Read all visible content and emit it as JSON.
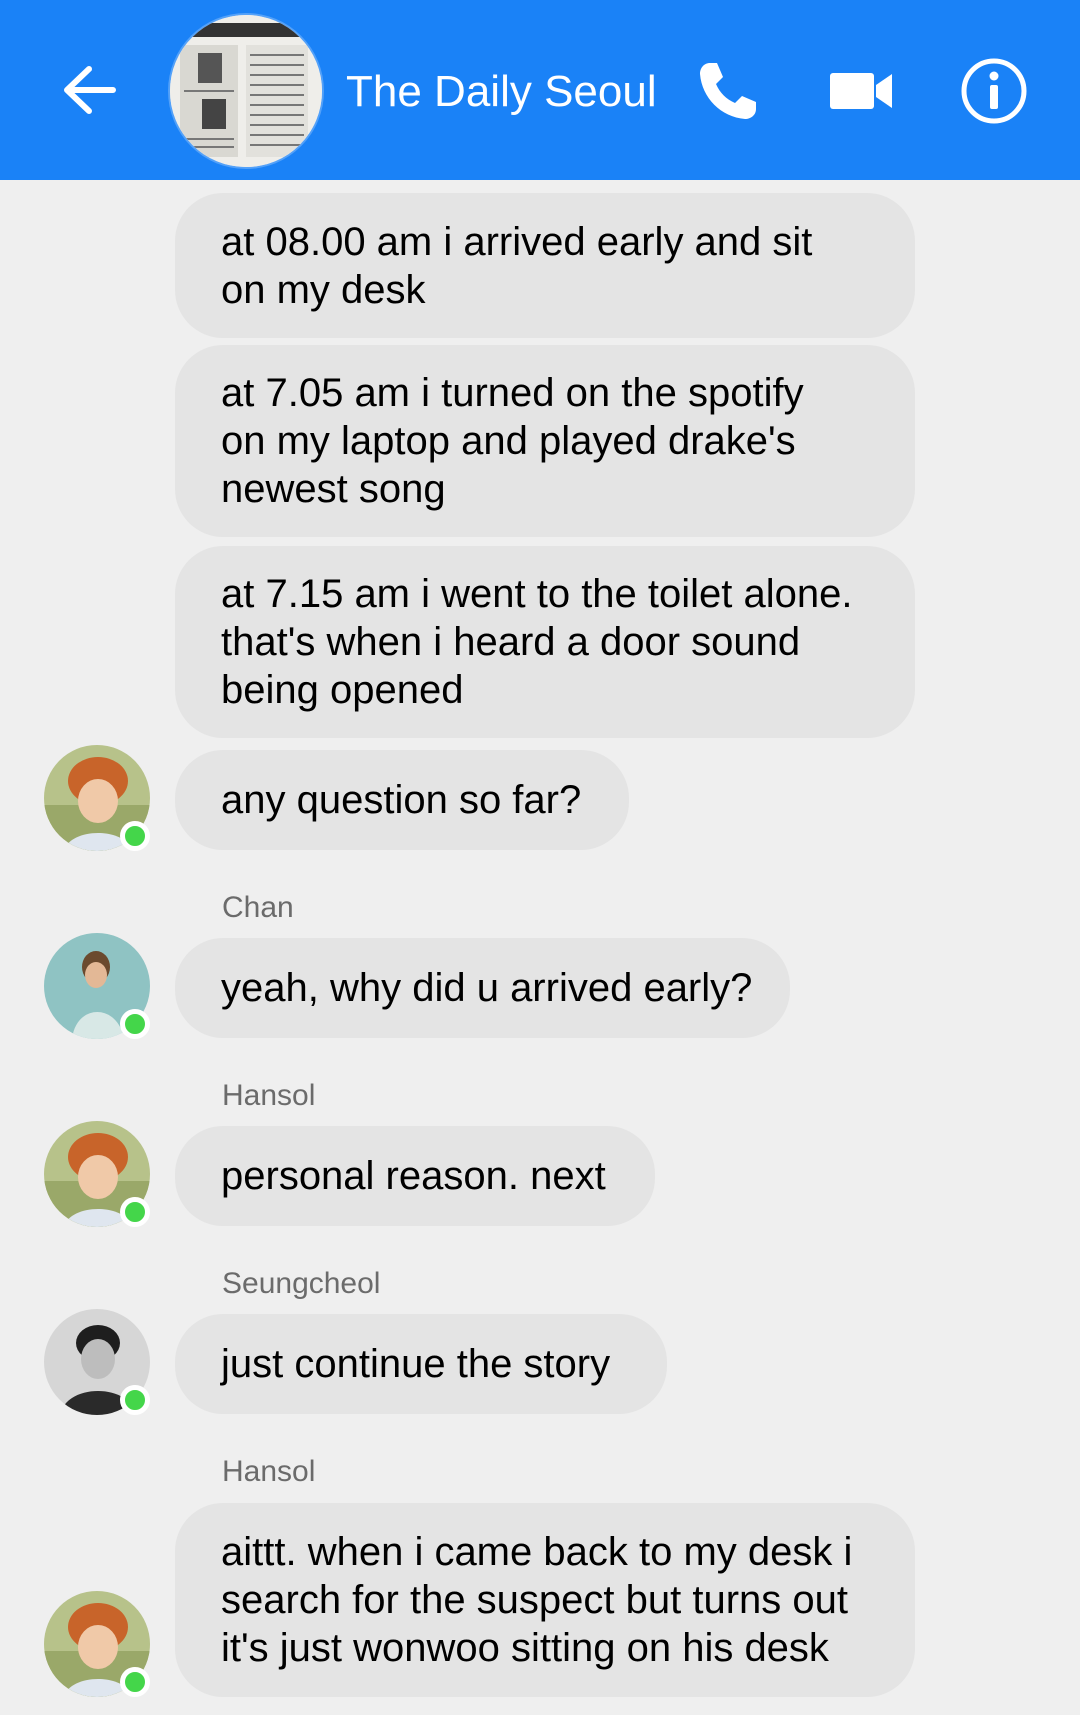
{
  "header": {
    "title": "The Daily Seoul",
    "back_icon": "arrow-left-icon",
    "call_icon": "phone-icon",
    "video_icon": "video-camera-icon",
    "info_icon": "info-icon",
    "background_color": "#1a82f7"
  },
  "messages": [
    {
      "lines": [
        "at 08.00 am i arrived early and sit",
        "on my desk"
      ]
    },
    {
      "lines": [
        "at 7.05 am i turned on the spotify",
        "on my laptop and played drake's",
        "newest song"
      ]
    },
    {
      "lines": [
        "at 7.15 am i went to the toilet alone.",
        "that's when i heard a door sound",
        "being opened"
      ]
    },
    {
      "lines": [
        "any question so far?"
      ]
    },
    {
      "sender": "Chan",
      "lines": [
        "yeah, why did u arrived early?"
      ]
    },
    {
      "sender": "Hansol",
      "lines": [
        "personal reason. next"
      ]
    },
    {
      "sender": "Seungcheol",
      "lines": [
        "just continue the story"
      ]
    },
    {
      "sender": "Hansol",
      "lines": [
        "aittt. when i came back to my desk i",
        "search for the suspect but turns out",
        "it's just wonwoo sitting on his desk"
      ]
    }
  ],
  "colors": {
    "bubble": "#e4e4e4",
    "online": "#44d64a",
    "background": "#efefef"
  }
}
